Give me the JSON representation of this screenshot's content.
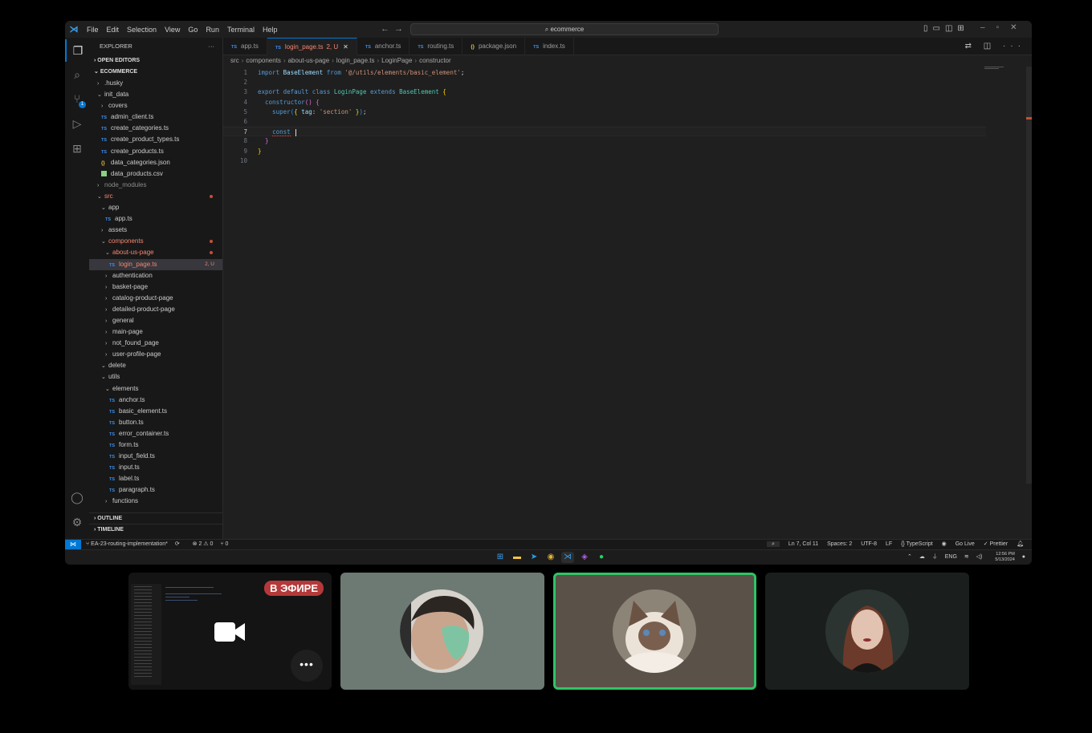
{
  "menu": [
    "File",
    "Edit",
    "Selection",
    "View",
    "Go",
    "Run",
    "Terminal",
    "Help"
  ],
  "search": "ecommerce",
  "sidebar": {
    "title": "EXPLORER",
    "open_editors": "OPEN EDITORS",
    "project": "ECOMMERCE",
    "outline": "OUTLINE",
    "timeline": "TIMELINE",
    "tree": [
      {
        "label": ".husky",
        "indent": 0,
        "kind": "folder",
        "open": false
      },
      {
        "label": "init_data",
        "indent": 0,
        "kind": "folder",
        "open": true
      },
      {
        "label": "covers",
        "indent": 1,
        "kind": "folder",
        "open": false
      },
      {
        "label": "admin_client.ts",
        "indent": 1,
        "kind": "ts"
      },
      {
        "label": "create_categories.ts",
        "indent": 1,
        "kind": "ts"
      },
      {
        "label": "create_product_types.ts",
        "indent": 1,
        "kind": "ts"
      },
      {
        "label": "create_products.ts",
        "indent": 1,
        "kind": "ts"
      },
      {
        "label": "data_categories.json",
        "indent": 1,
        "kind": "json"
      },
      {
        "label": "data_products.csv",
        "indent": 1,
        "kind": "csv"
      },
      {
        "label": "node_modules",
        "indent": 0,
        "kind": "folder",
        "open": false,
        "dim": true
      },
      {
        "label": "src",
        "indent": 0,
        "kind": "folder",
        "open": true,
        "err": true,
        "dot": true
      },
      {
        "label": "app",
        "indent": 1,
        "kind": "folder",
        "open": true
      },
      {
        "label": "app.ts",
        "indent": 2,
        "kind": "ts"
      },
      {
        "label": "assets",
        "indent": 1,
        "kind": "folder",
        "open": false
      },
      {
        "label": "components",
        "indent": 1,
        "kind": "folder",
        "open": true,
        "err": true,
        "dot": true
      },
      {
        "label": "about-us-page",
        "indent": 2,
        "kind": "folder",
        "open": true,
        "err": true,
        "dot": true
      },
      {
        "label": "login_page.ts",
        "indent": 3,
        "kind": "ts",
        "selected": true,
        "status": "2, U"
      },
      {
        "label": "authentication",
        "indent": 2,
        "kind": "folder",
        "open": false
      },
      {
        "label": "basket-page",
        "indent": 2,
        "kind": "folder",
        "open": false
      },
      {
        "label": "catalog-product-page",
        "indent": 2,
        "kind": "folder",
        "open": false
      },
      {
        "label": "detailed-product-page",
        "indent": 2,
        "kind": "folder",
        "open": false
      },
      {
        "label": "general",
        "indent": 2,
        "kind": "folder",
        "open": false
      },
      {
        "label": "main-page",
        "indent": 2,
        "kind": "folder",
        "open": false
      },
      {
        "label": "not_found_page",
        "indent": 2,
        "kind": "folder",
        "open": false
      },
      {
        "label": "user-profile-page",
        "indent": 2,
        "kind": "folder",
        "open": false
      },
      {
        "label": "delete",
        "indent": 1,
        "kind": "folder",
        "open": true
      },
      {
        "label": "utils",
        "indent": 1,
        "kind": "folder",
        "open": true
      },
      {
        "label": "elements",
        "indent": 2,
        "kind": "folder",
        "open": true
      },
      {
        "label": "anchor.ts",
        "indent": 3,
        "kind": "ts"
      },
      {
        "label": "basic_element.ts",
        "indent": 3,
        "kind": "ts"
      },
      {
        "label": "button.ts",
        "indent": 3,
        "kind": "ts"
      },
      {
        "label": "error_container.ts",
        "indent": 3,
        "kind": "ts"
      },
      {
        "label": "form.ts",
        "indent": 3,
        "kind": "ts"
      },
      {
        "label": "input_field.ts",
        "indent": 3,
        "kind": "ts"
      },
      {
        "label": "input.ts",
        "indent": 3,
        "kind": "ts"
      },
      {
        "label": "label.ts",
        "indent": 3,
        "kind": "ts"
      },
      {
        "label": "paragraph.ts",
        "indent": 3,
        "kind": "ts"
      },
      {
        "label": "functions",
        "indent": 2,
        "kind": "folder",
        "open": false
      }
    ]
  },
  "tabs": [
    {
      "label": "app.ts",
      "kind": "ts"
    },
    {
      "label": "login_page.ts",
      "kind": "ts",
      "active": true,
      "suffix": "2, U"
    },
    {
      "label": "anchor.ts",
      "kind": "ts"
    },
    {
      "label": "routing.ts",
      "kind": "ts"
    },
    {
      "label": "package.json",
      "kind": "json"
    },
    {
      "label": "index.ts",
      "kind": "ts"
    }
  ],
  "breadcrumb": [
    "src",
    "components",
    "about-us-page",
    "login_page.ts",
    "LoginPage",
    "constructor"
  ],
  "code": {
    "line_numbers": [
      "1",
      "2",
      "3",
      "4",
      "5",
      "6",
      "7",
      "8",
      "9",
      "10"
    ],
    "current_line": 7,
    "lines": [
      [
        {
          "t": "import ",
          "c": "kw"
        },
        {
          "t": "BaseElement ",
          "c": "pr"
        },
        {
          "t": "from ",
          "c": "kw"
        },
        {
          "t": "'@/utils/elements/basic_element'",
          "c": "str"
        },
        {
          "t": ";",
          "c": "pun"
        }
      ],
      [],
      [
        {
          "t": "export default class ",
          "c": "kw"
        },
        {
          "t": "LoginPage ",
          "c": "cls"
        },
        {
          "t": "extends ",
          "c": "kw"
        },
        {
          "t": "BaseElement ",
          "c": "cls"
        },
        {
          "t": "{",
          "c": "br1"
        }
      ],
      [
        {
          "t": "  constructor",
          "c": "kw"
        },
        {
          "t": "() ",
          "c": "br2"
        },
        {
          "t": "{",
          "c": "br2"
        }
      ],
      [
        {
          "t": "    super",
          "c": "kw"
        },
        {
          "t": "(",
          "c": "br3"
        },
        {
          "t": "{ ",
          "c": "br1"
        },
        {
          "t": "tag",
          "c": "pr"
        },
        {
          "t": ": ",
          "c": "pun"
        },
        {
          "t": "'section' ",
          "c": "str"
        },
        {
          "t": "}",
          "c": "br1"
        },
        {
          "t": ")",
          "c": "br3"
        },
        {
          "t": ";",
          "c": "pun"
        }
      ],
      [],
      [
        {
          "t": "    ",
          "c": "pun"
        },
        {
          "t": "const",
          "c": "kw squig"
        },
        {
          "t": " ",
          "c": "pun"
        }
      ],
      [
        {
          "t": "  }",
          "c": "br2"
        }
      ],
      [
        {
          "t": "}",
          "c": "br1"
        }
      ],
      []
    ]
  },
  "status": {
    "branch": "EA-23-routing-implementation*",
    "sync": "⟳",
    "problems": "⊗ 2 ⚠ 0",
    "ports": "⑂ 0",
    "position": "Ln 7, Col 11",
    "spaces": "Spaces: 2",
    "encoding": "UTF-8",
    "eol": "LF",
    "language": "{} TypeScript",
    "golive": "Go Live",
    "prettier": "✓ Prettier"
  },
  "tray": {
    "lang": "ENG",
    "time": "12:56 PM",
    "date": "5/13/2024"
  },
  "call": {
    "live_label": "В ЭФИРЕ",
    "more": "•••"
  },
  "colors": {
    "accent": "#0078d4",
    "error": "#f48771",
    "speaker_border": "#2fc467",
    "live_badge": "#b5393a"
  }
}
